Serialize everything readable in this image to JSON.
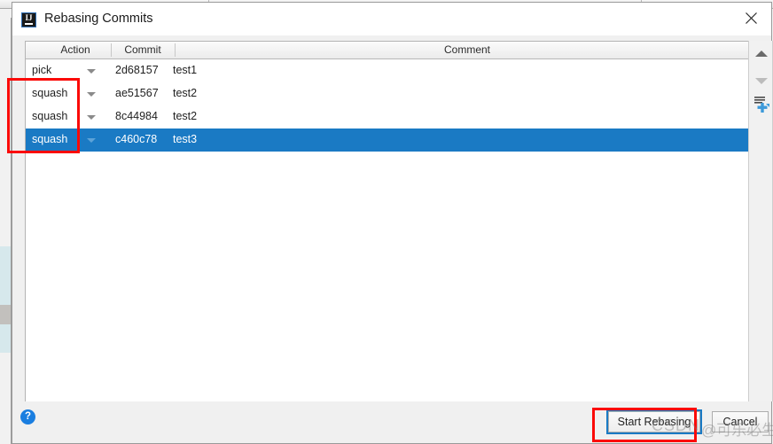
{
  "window": {
    "title": "Rebasing Commits",
    "app_icon": "intellij-idea-logo",
    "app_icon_text": "IJ",
    "close_icon": "close-icon"
  },
  "table": {
    "columns": [
      {
        "key": "action",
        "label": "Action"
      },
      {
        "key": "commit",
        "label": "Commit"
      },
      {
        "key": "comment",
        "label": "Comment"
      }
    ],
    "rows": [
      {
        "action": "pick",
        "commit": "2d68157",
        "comment": "test1",
        "selected": false
      },
      {
        "action": "squash",
        "commit": "ae51567",
        "comment": "test2",
        "selected": false
      },
      {
        "action": "squash",
        "commit": "8c44984",
        "comment": "test2",
        "selected": false
      },
      {
        "action": "squash",
        "commit": "c460c78",
        "comment": "test3",
        "selected": true
      }
    ]
  },
  "side_toolbar": {
    "buttons": [
      {
        "name": "move-up-button",
        "icon": "arrow-up-icon",
        "enabled": true
      },
      {
        "name": "move-down-button",
        "icon": "arrow-down-icon",
        "enabled": false
      },
      {
        "name": "squash-commits-button",
        "icon": "squash-merge-icon",
        "enabled": true
      }
    ]
  },
  "footer": {
    "help_label": "?",
    "start_rebasing_label": "Start Rebasing",
    "cancel_label": "Cancel"
  },
  "annotations": [
    {
      "name": "annotation-action-column",
      "color": "#fb0a08"
    },
    {
      "name": "annotation-footer-buttons",
      "color": "#fb0a08"
    }
  ],
  "watermark": {
    "latin": "CSDN",
    "cjk": "@可乐必生"
  },
  "colors": {
    "selection": "#1a7ac4",
    "accent": "#1a7ee0",
    "annotation": "#fb0a08",
    "dialog_bg": "#f0f0f0",
    "table_bg": "#ffffff"
  }
}
